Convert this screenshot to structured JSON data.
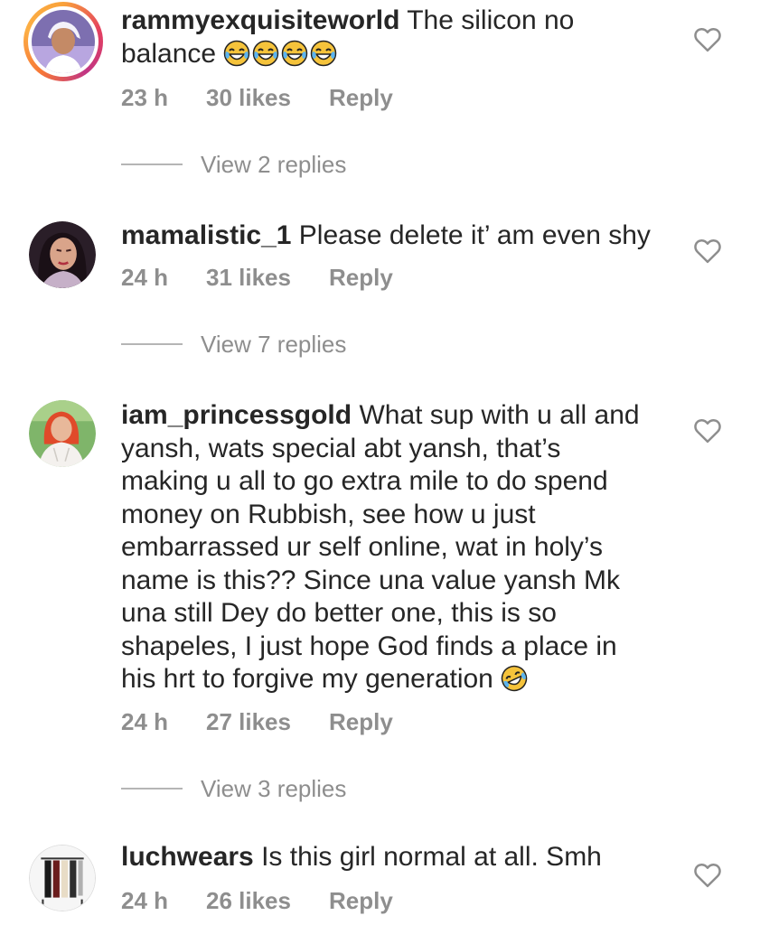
{
  "comments": [
    {
      "username": "rammyexquisiteworld",
      "text": "The silicon no balance",
      "emoji": "😂😂😂😂",
      "time": "23 h",
      "likes": "30 likes",
      "reply": "Reply",
      "view_replies": "View 2 replies",
      "avatar_icon": "avatar-person-headwrap"
    },
    {
      "username": "mamalistic_1",
      "text": "Please delete it’ am even shy",
      "time": "24 h",
      "likes": "31 likes",
      "reply": "Reply",
      "view_replies": "View 7 replies",
      "avatar_icon": "avatar-person-makeup"
    },
    {
      "username": "iam_princessgold",
      "text": "What sup with u all and yansh, wats special abt yansh, that’s making u all to go extra mile to do spend money on Rubbish, see how u just embarrassed ur self online, wat in holy’s name is this?? Since una value yansh Mk una still Dey do better one, this is so shapeles, I just hope God finds a place in his hrt to forgive my generation",
      "emoji": "🤣",
      "time": "24 h",
      "likes": "27 likes",
      "reply": "Reply",
      "view_replies": "View 3 replies",
      "avatar_icon": "avatar-person-red-hair"
    },
    {
      "username": "luchwears",
      "text": "Is this girl normal at all. Smh",
      "time": "24 h",
      "likes": "26 likes",
      "reply": "Reply",
      "avatar_icon": "avatar-clothes-rack"
    }
  ],
  "colors": {
    "text": "#262626",
    "muted": "#8e8e8e",
    "story_ring_start": "#f9a23a",
    "story_ring_end": "#c13584"
  },
  "icons": {
    "like": "heart-outline-icon"
  }
}
